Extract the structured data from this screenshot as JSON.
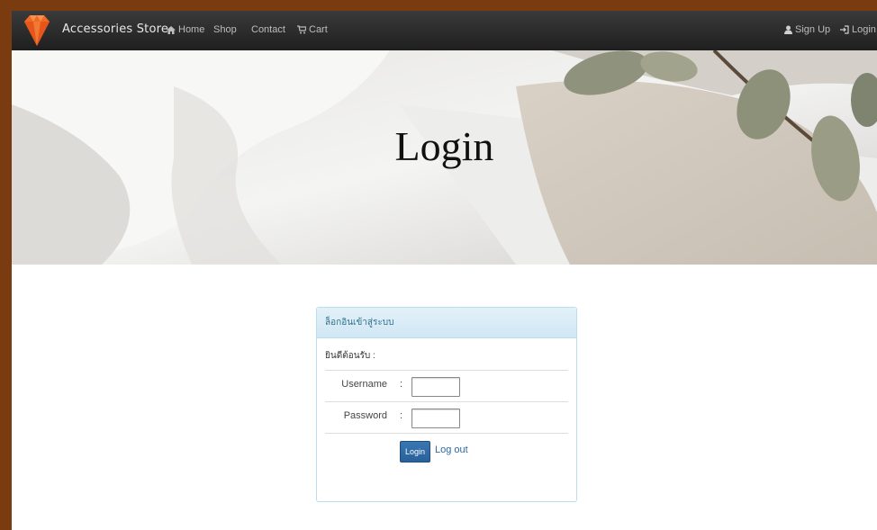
{
  "navbar": {
    "brand": "Accessories Store",
    "items": [
      {
        "label": "Home",
        "icon": "home-icon"
      },
      {
        "label": "Shop"
      },
      {
        "label": "Contact"
      },
      {
        "label": "Cart",
        "icon": "cart-icon"
      }
    ],
    "right_items": [
      {
        "label": "Sign Up",
        "icon": "user-icon"
      },
      {
        "label": "Login",
        "icon": "login-icon"
      }
    ]
  },
  "hero": {
    "title": "Login"
  },
  "login_panel": {
    "heading": "ล็อกอินเข้าสู่ระบบ",
    "welcome": "ยินดีต้อนรับ :",
    "username_label": "Username",
    "password_label": "Password",
    "colon": ":",
    "username_value": "",
    "password_value": "",
    "login_button": "Login",
    "logout_link": "Log out"
  },
  "colors": {
    "frame": "#7a3b10",
    "navbar": "#2a2a2a",
    "logo": "#f26522",
    "panel_heading": "#d9edf7",
    "primary_button": "#2f6ba6"
  }
}
